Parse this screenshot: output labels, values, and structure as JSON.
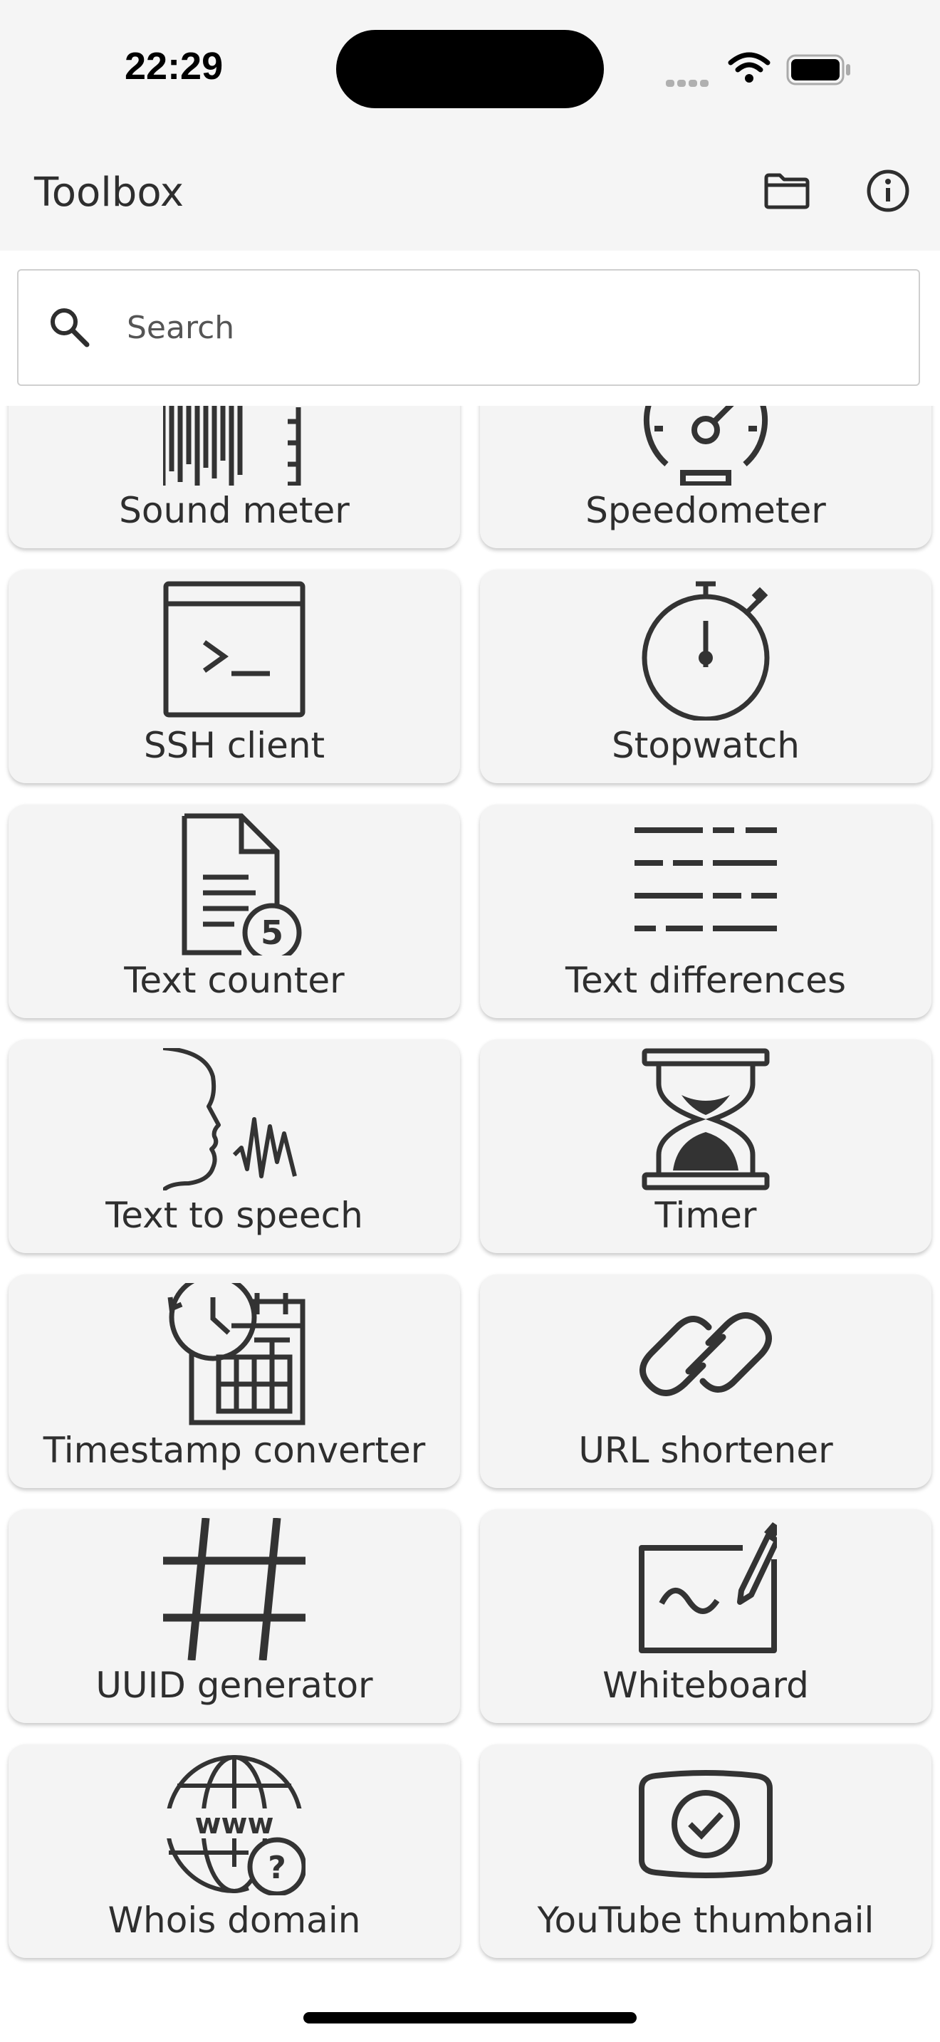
{
  "status_bar": {
    "time": "22:29"
  },
  "app_bar": {
    "title": "Toolbox",
    "folder_icon": "folder-icon",
    "info_icon": "info-icon"
  },
  "search": {
    "placeholder": "Search",
    "value": ""
  },
  "tools": [
    {
      "label": "Sound meter",
      "icon": "sound-meter-icon"
    },
    {
      "label": "Speedometer",
      "icon": "speedometer-icon"
    },
    {
      "label": "SSH client",
      "icon": "terminal-icon"
    },
    {
      "label": "Stopwatch",
      "icon": "stopwatch-icon"
    },
    {
      "label": "Text counter",
      "icon": "text-counter-icon",
      "badge": "5"
    },
    {
      "label": "Text differences",
      "icon": "text-differences-icon"
    },
    {
      "label": "Text to speech",
      "icon": "text-to-speech-icon"
    },
    {
      "label": "Timer",
      "icon": "hourglass-icon"
    },
    {
      "label": "Timestamp converter",
      "icon": "calendar-clock-icon"
    },
    {
      "label": "URL shortener",
      "icon": "link-icon"
    },
    {
      "label": "UUID generator",
      "icon": "hash-icon"
    },
    {
      "label": "Whiteboard",
      "icon": "whiteboard-icon"
    },
    {
      "label": "Whois domain",
      "icon": "whois-globe-icon",
      "icon_text": "www",
      "badge": "?"
    },
    {
      "label": "YouTube thumbnail",
      "icon": "youtube-thumbnail-icon"
    }
  ]
}
